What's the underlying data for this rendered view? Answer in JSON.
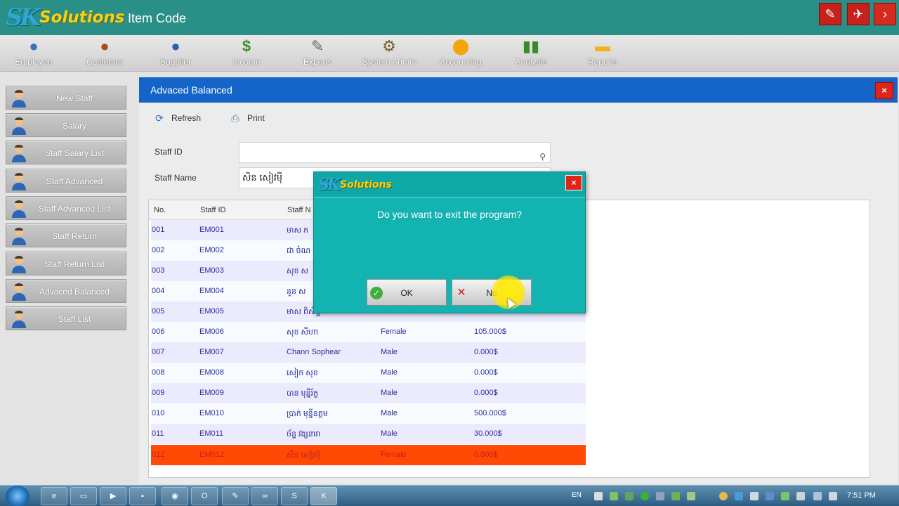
{
  "window": {
    "logo_sk": "SK",
    "logo_text": "Solutions",
    "title": "Item Code"
  },
  "menu": [
    {
      "label": "Employee",
      "icon": "employee-icon",
      "glyph": "👤"
    },
    {
      "label": "Customer",
      "icon": "customer-icon",
      "glyph": "👥"
    },
    {
      "label": "Supplier",
      "icon": "supplier-icon",
      "glyph": "👤"
    },
    {
      "label": "Income",
      "icon": "income-icon",
      "glyph": "$"
    },
    {
      "label": "Expens",
      "icon": "expens-icon",
      "glyph": "✎"
    },
    {
      "label": "System Admin",
      "icon": "system-admin-icon",
      "glyph": "⚙"
    },
    {
      "label": "Accounting",
      "icon": "accounting-icon",
      "glyph": "●"
    },
    {
      "label": "Analysis",
      "icon": "analysis-icon",
      "glyph": "▮"
    },
    {
      "label": "Reports",
      "icon": "reports-icon",
      "glyph": "▬"
    }
  ],
  "sidebar": [
    {
      "label": "New Staff"
    },
    {
      "label": "Salary"
    },
    {
      "label": "Staff Salary List"
    },
    {
      "label": "Staff Advanced"
    },
    {
      "label": "Staff Advanced List"
    },
    {
      "label": "Staff Return"
    },
    {
      "label": "Staff Return List"
    },
    {
      "label": "Advaced Balanced"
    },
    {
      "label": "Staff List"
    }
  ],
  "panel": {
    "title": "Advaced Balanced",
    "close": "×",
    "refresh_label": "Refresh",
    "print_label": "Print",
    "staff_id_label": "Staff ID",
    "staff_id_value": "",
    "staff_name_label": "Staff Name",
    "staff_name_value": "សិន សៀវម៉ី"
  },
  "grid": {
    "headers": [
      "No.",
      "Staff ID",
      "Staff N"
    ],
    "rows": [
      {
        "no": "001",
        "id": "EM001",
        "name": "មាស ភ",
        "gender": "",
        "amount": ""
      },
      {
        "no": "002",
        "id": "EM002",
        "name": "ជា ចំណ",
        "gender": "",
        "amount": ""
      },
      {
        "no": "003",
        "id": "EM003",
        "name": "សុខ ស",
        "gender": "",
        "amount": ""
      },
      {
        "no": "004",
        "id": "EM004",
        "name": "នួន ស",
        "gender": "",
        "amount": ""
      },
      {
        "no": "005",
        "id": "EM005",
        "name": "មាស ពិសិដ្ឋ",
        "gender": "",
        "amount": ""
      },
      {
        "no": "006",
        "id": "EM006",
        "name": "សុខ សីហា",
        "gender": "Female",
        "amount": "105.000$"
      },
      {
        "no": "007",
        "id": "EM007",
        "name": "Chann Sophear",
        "gender": "Male",
        "amount": "0.000$"
      },
      {
        "no": "008",
        "id": "EM008",
        "name": "សៀក សុខ",
        "gender": "Male",
        "amount": "0.000$"
      },
      {
        "no": "009",
        "id": "EM009",
        "name": "បាន មុន្នីរ័ក្ខ",
        "gender": "Male",
        "amount": "0.000$"
      },
      {
        "no": "010",
        "id": "EM010",
        "name": "ប្រាក់ មុន្នីឧត្តម",
        "gender": "Male",
        "amount": "500.000$"
      },
      {
        "no": "011",
        "id": "EM011",
        "name": "ច័ន្ទ វង្សនារា",
        "gender": "Male",
        "amount": "30.000$"
      },
      {
        "no": "012",
        "id": "EM012",
        "name": "សិន សៀវម៉ី",
        "gender": "Female",
        "amount": "0.000$"
      }
    ]
  },
  "dialog": {
    "logo_sk": "SK",
    "logo_text": "Solutions",
    "close": "×",
    "message": "Do you want to exit the program?",
    "ok_label": "OK",
    "no_label": "No"
  },
  "taskbar": {
    "lang": "EN",
    "time": "7:51 PM",
    "apps": [
      {
        "icon": "ie-icon",
        "glyph": "e"
      },
      {
        "icon": "explorer-icon",
        "glyph": "▭"
      },
      {
        "icon": "media-player-icon",
        "glyph": "▶"
      },
      {
        "icon": "app-icon",
        "glyph": "▪"
      },
      {
        "icon": "chrome-icon",
        "glyph": "◉"
      },
      {
        "icon": "outlook-icon",
        "glyph": "O"
      },
      {
        "icon": "paint-icon",
        "glyph": "✎"
      },
      {
        "icon": "network-icon",
        "glyph": "∞"
      },
      {
        "icon": "skype-icon",
        "glyph": "S"
      },
      {
        "icon": "sk-solutions-icon",
        "glyph": "K"
      }
    ]
  },
  "colors": {
    "title_bar": "#2a8f86",
    "panel_header": "#1565c8",
    "dialog_bg": "#12b3b1",
    "selected_row": "#ff4a06",
    "close_red": "#e02418"
  }
}
